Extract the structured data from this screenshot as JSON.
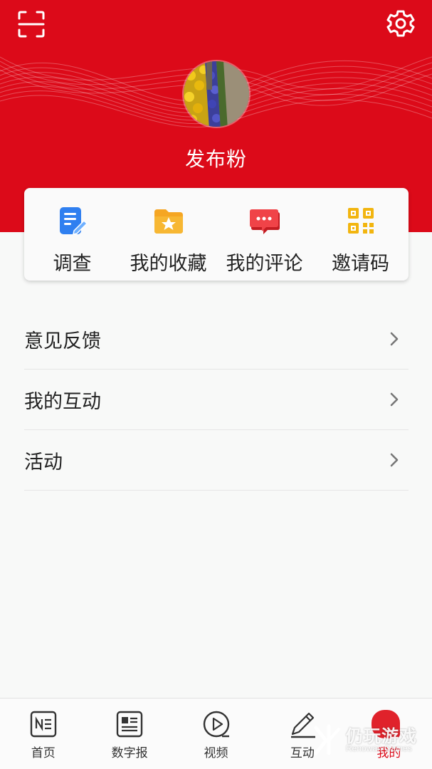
{
  "header": {
    "username": "发布粉",
    "scan_icon": "scan-icon",
    "settings_icon": "gear-icon",
    "background_color": "#dc0a19"
  },
  "quick_actions": [
    {
      "label": "调查",
      "icon": "survey-icon",
      "color": "#2f7ff0"
    },
    {
      "label": "我的收藏",
      "icon": "favorites-folder-icon",
      "color": "#f5a623"
    },
    {
      "label": "我的评论",
      "icon": "comment-bubble-icon",
      "color": "#e8343a"
    },
    {
      "label": "邀请码",
      "icon": "qr-code-icon",
      "color": "#f2b50f"
    }
  ],
  "menu": [
    {
      "label": "意见反馈"
    },
    {
      "label": "我的互动"
    },
    {
      "label": "活动"
    }
  ],
  "tabbar": {
    "tabs": [
      {
        "label": "首页",
        "icon": "home-news-icon"
      },
      {
        "label": "数字报",
        "icon": "digital-newspaper-icon"
      },
      {
        "label": "视频",
        "icon": "video-play-icon"
      },
      {
        "label": "互动",
        "icon": "pen-icon"
      },
      {
        "label": "我的",
        "icon": "me-icon"
      }
    ],
    "active_index": 4,
    "active_color": "#dc0a19"
  },
  "watermark": {
    "text": "仍玩游戏",
    "subtext": "Renowan Games"
  }
}
